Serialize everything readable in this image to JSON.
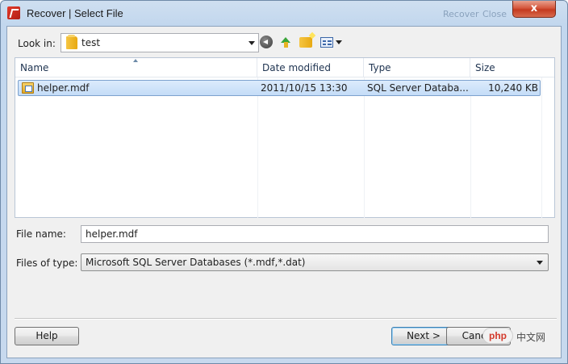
{
  "window": {
    "title": "Recover | Select File",
    "ghost_labels": [
      "Recover",
      "Close"
    ],
    "close_glyph": "x"
  },
  "toolbar": {
    "look_in_label": "Look in:",
    "look_in_value": "test",
    "icons": [
      "back-icon",
      "up-folder-icon",
      "new-folder-icon",
      "views-menu-icon"
    ]
  },
  "filelist": {
    "columns": [
      "Name",
      "Date modified",
      "Type",
      "Size"
    ],
    "rows": [
      {
        "name": "helper.mdf",
        "date_modified": "2011/10/15 13:30",
        "type": "SQL Server Databa...",
        "size": "10,240 KB"
      }
    ]
  },
  "form": {
    "file_name_label": "File name:",
    "file_name_value": "helper.mdf",
    "files_of_type_label": "Files of type:",
    "files_of_type_value": "Microsoft SQL Server Databases (*.mdf,*.dat)"
  },
  "buttons": {
    "help": "Help",
    "next": "Next >",
    "cancel": "Cancel"
  },
  "watermark": {
    "badge": "php",
    "text": "中文网"
  },
  "colors": {
    "selection": "#c4dcf7",
    "selection_border": "#7da2ce",
    "close_button": "#c43a1f",
    "frame": "#c2d7ee"
  }
}
